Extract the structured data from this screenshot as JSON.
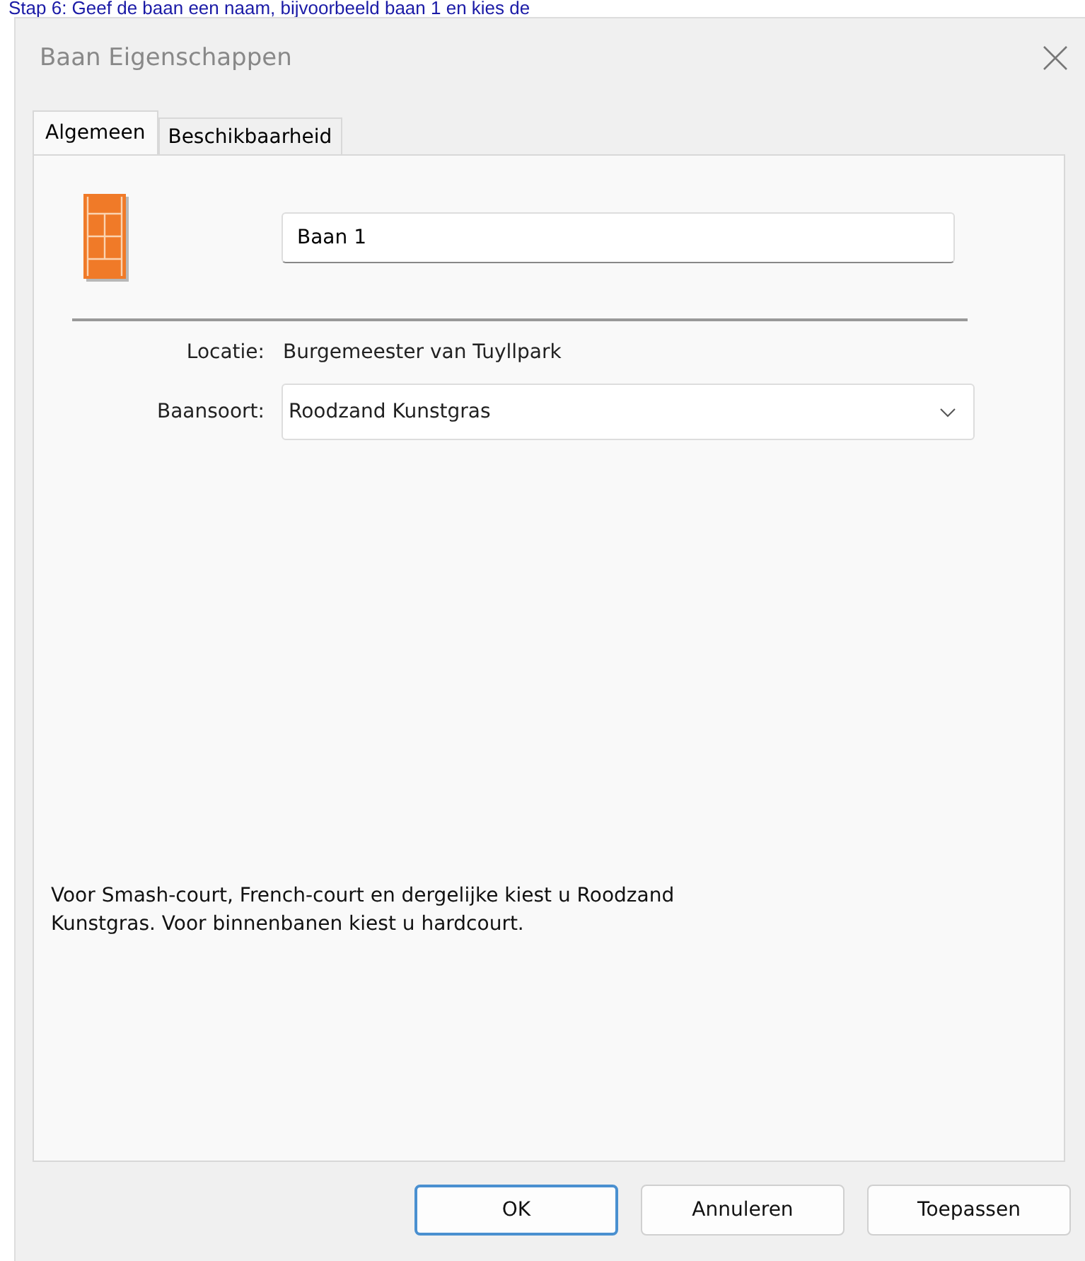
{
  "page_heading": "Stap 6: Geef de baan een naam, bijvoorbeeld baan 1 en kies de",
  "window": {
    "title": "Baan Eigenschappen"
  },
  "tabs": [
    {
      "label": "Algemeen",
      "selected": true
    },
    {
      "label": "Beschikbaarheid",
      "selected": false
    }
  ],
  "name_field": {
    "value": "Baan 1"
  },
  "location": {
    "label": "Locatie:",
    "value": "Burgemeester van Tuyllpark"
  },
  "court_type": {
    "label": "Baansoort:",
    "value": "Roodzand Kunstgras"
  },
  "note": "Voor Smash-court, French-court en dergelijke kiest u Roodzand Kunstgras. Voor binnenbanen kiest u hardcourt.",
  "buttons": [
    {
      "label": "OK",
      "default": true
    },
    {
      "label": "Annuleren",
      "default": false
    },
    {
      "label": "Toepassen",
      "default": false
    }
  ]
}
